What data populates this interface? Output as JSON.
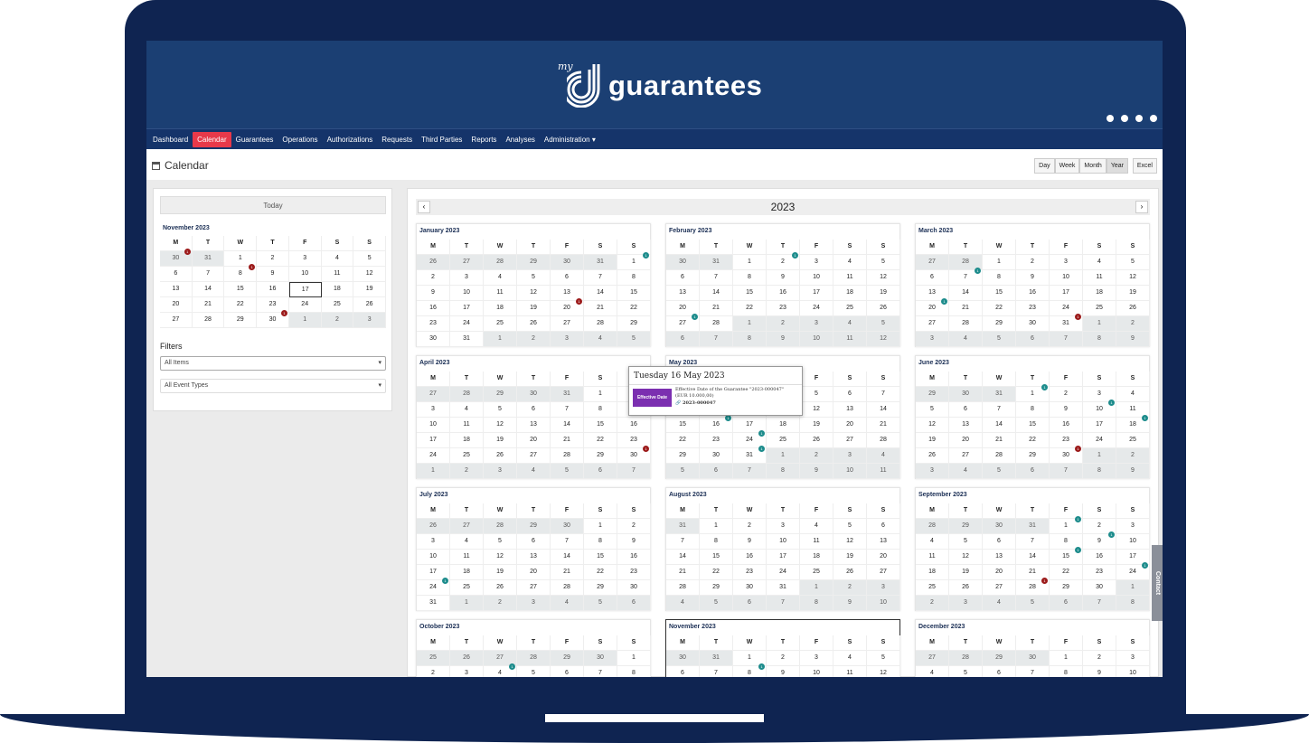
{
  "app": {
    "logo_prefix": "my",
    "logo_text": "guarantees"
  },
  "top_icons": [
    "bell-icon",
    "help-icon",
    "user-icon",
    "power-icon"
  ],
  "nav": [
    "Dashboard",
    "Calendar",
    "Guarantees",
    "Operations",
    "Authorizations",
    "Requests",
    "Third Parties",
    "Reports",
    "Analyses",
    "Administration ▾"
  ],
  "page": {
    "title": "Calendar"
  },
  "views": [
    "Day",
    "Week",
    "Month",
    "Year"
  ],
  "active_view": "Year",
  "excel": "Excel",
  "left": {
    "today": "Today",
    "filters_label": "Filters",
    "filter1": "All Items",
    "filter2": "All Event Types"
  },
  "year": "2023",
  "weekdays": [
    "M",
    "T",
    "W",
    "T",
    "F",
    "S",
    "S"
  ],
  "mini": {
    "title": "November 2023",
    "weeks": [
      [
        "30",
        "31",
        "1",
        "2",
        "3",
        "4",
        "5"
      ],
      [
        "6",
        "7",
        "8",
        "9",
        "10",
        "11",
        "12"
      ],
      [
        "13",
        "14",
        "15",
        "16",
        "17",
        "18",
        "19"
      ],
      [
        "20",
        "21",
        "22",
        "23",
        "24",
        "25",
        "26"
      ],
      [
        "27",
        "28",
        "29",
        "30",
        "1",
        "2",
        "3"
      ]
    ],
    "selected": "17",
    "events": [
      {
        "w": 0,
        "d": 0,
        "n": "1",
        "c": "red"
      },
      {
        "w": 1,
        "d": 2,
        "n": "1",
        "c": "red"
      },
      {
        "w": 4,
        "d": 3,
        "n": "1",
        "c": "red"
      }
    ]
  },
  "months": [
    {
      "title": "January 2023",
      "first": 6,
      "days": 31,
      "events": [
        {
          "d": 1,
          "n": "1",
          "c": "teal"
        },
        {
          "d": 20,
          "n": "1",
          "c": "red"
        }
      ]
    },
    {
      "title": "February 2023",
      "first": 2,
      "days": 28,
      "events": [
        {
          "d": 2,
          "n": "1",
          "c": "teal"
        },
        {
          "d": 27,
          "n": "1",
          "c": "teal"
        }
      ]
    },
    {
      "title": "March 2023",
      "first": 2,
      "days": 31,
      "events": [
        {
          "d": 7,
          "n": "1",
          "c": "teal"
        },
        {
          "d": 20,
          "n": "1",
          "c": "teal"
        },
        {
          "d": 31,
          "n": "1",
          "c": "red"
        }
      ]
    },
    {
      "title": "April 2023",
      "first": 5,
      "days": 30,
      "events": [
        {
          "d": 30,
          "n": "1",
          "c": "red"
        }
      ]
    },
    {
      "title": "May 2023",
      "first": 0,
      "days": 31,
      "events": [
        {
          "d": 16,
          "n": "1",
          "c": "teal"
        },
        {
          "d": 24,
          "n": "1",
          "c": "teal"
        },
        {
          "d": 31,
          "n": "1",
          "c": "teal"
        }
      ]
    },
    {
      "title": "June 2023",
      "first": 3,
      "days": 30,
      "events": [
        {
          "d": 1,
          "n": "1",
          "c": "teal"
        },
        {
          "d": 10,
          "n": "1",
          "c": "teal"
        },
        {
          "d": 18,
          "n": "1",
          "c": "teal"
        },
        {
          "d": 30,
          "n": "1",
          "c": "red"
        }
      ]
    },
    {
      "title": "July 2023",
      "first": 5,
      "days": 31,
      "events": [
        {
          "d": 24,
          "n": "1",
          "c": "teal"
        }
      ]
    },
    {
      "title": "August 2023",
      "first": 1,
      "days": 31,
      "events": []
    },
    {
      "title": "September 2023",
      "first": 4,
      "days": 30,
      "events": [
        {
          "d": 1,
          "n": "1",
          "c": "teal"
        },
        {
          "d": 9,
          "n": "1",
          "c": "teal"
        },
        {
          "d": 15,
          "n": "1",
          "c": "teal"
        },
        {
          "d": 24,
          "n": "1",
          "c": "teal"
        },
        {
          "d": 28,
          "n": "1",
          "c": "red"
        }
      ]
    },
    {
      "title": "October 2023",
      "first": 6,
      "days": 31,
      "events": [
        {
          "d": 4,
          "n": "1",
          "c": "teal"
        }
      ]
    },
    {
      "title": "November 2023",
      "first": 2,
      "days": 30,
      "events": [
        {
          "d": 8,
          "n": "1",
          "c": "teal"
        }
      ]
    },
    {
      "title": "December 2023",
      "first": 4,
      "days": 31,
      "events": []
    }
  ],
  "tooltip": {
    "title": "Tuesday 16 May 2023",
    "badge": "Effective Date",
    "desc": "Effective Date of the Guarantee \"2023-000047\" (EUR 10.000,00)",
    "ref": "🔗 2023-000047"
  },
  "contact": "Contact"
}
